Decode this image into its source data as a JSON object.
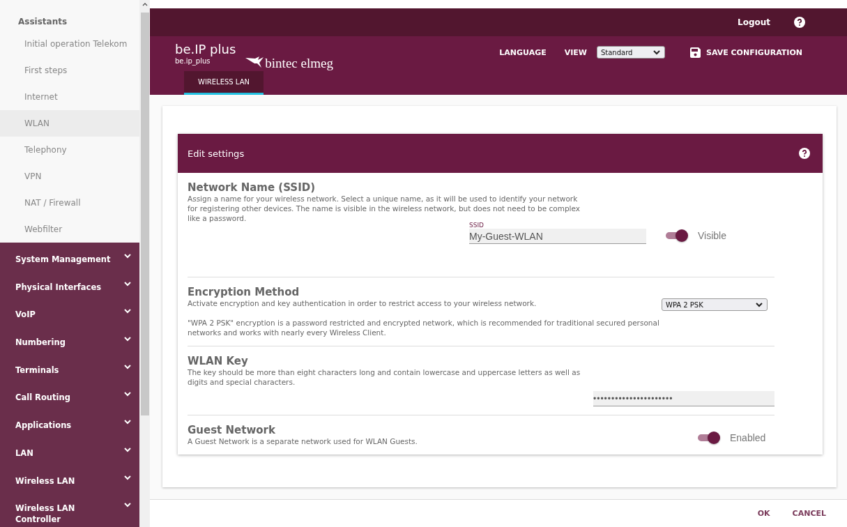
{
  "sidebar": {
    "section_title": "Assistants",
    "items": [
      {
        "label": "Initial operation Telekom",
        "selected": false
      },
      {
        "label": "First steps",
        "selected": false
      },
      {
        "label": "Internet",
        "selected": false
      },
      {
        "label": "WLAN",
        "selected": true
      },
      {
        "label": "Telephony",
        "selected": false
      },
      {
        "label": "VPN",
        "selected": false
      },
      {
        "label": "NAT / Firewall",
        "selected": false
      },
      {
        "label": "Webfilter",
        "selected": false
      }
    ],
    "groups": [
      {
        "label": "System Management",
        "expanded": false
      },
      {
        "label": "Physical Interfaces",
        "expanded": false
      },
      {
        "label": "VoIP",
        "expanded": false
      },
      {
        "label": "Numbering",
        "expanded": false
      },
      {
        "label": "Terminals",
        "expanded": false
      },
      {
        "label": "Call Routing",
        "expanded": false
      },
      {
        "label": "Applications",
        "expanded": false
      },
      {
        "label": "LAN",
        "expanded": false
      },
      {
        "label": "Wireless LAN",
        "expanded": false
      },
      {
        "label": "Wireless LAN Controller",
        "expanded": false
      }
    ]
  },
  "topbar": {
    "logout": "Logout"
  },
  "header": {
    "device": "be.IP plus",
    "hostname": "be.ip_plus",
    "brand": "bintec elmeg",
    "language": "LANGUAGE",
    "view_label": "VIEW",
    "view_value": "Standard",
    "save": "SAVE CONFIGURATION",
    "tabs": [
      {
        "label": "WIRELESS LAN",
        "selected": true
      }
    ]
  },
  "panel": {
    "title": "Edit settings",
    "sections": [
      {
        "kind": "text",
        "title": "Network Name (SSID)",
        "description": "Assign a name for your wireless network. Select a unique name, as it will be used to identify your network for registering other devices. The name is visible in the wireless network, but does not need to be complex like a password.",
        "field_label": "SSID",
        "value": "My-Guest-WLAN",
        "toggle": {
          "label": "Visible",
          "on": true
        }
      },
      {
        "kind": "select",
        "title": "Encryption Method",
        "description": "Activate encryption and key authentication in order to restrict access to your wireless network.",
        "value": "WPA 2 PSK",
        "note": "\"WPA 2 PSK\" encryption is a password restricted and encrypted network, which is recommended for traditional secured personal networks and works with nearly every Wireless Client."
      },
      {
        "kind": "password",
        "title": "WLAN Key",
        "description": "The key should be more than eight characters long and contain lowercase and uppercase letters as well as digits and special characters.",
        "value": "••••••••••••••••••••••"
      },
      {
        "kind": "toggle",
        "title": "Guest Network",
        "description": "A Guest Network is a separate network used for WLAN Guests.",
        "toggle": {
          "label": "Enabled",
          "on": true
        }
      }
    ]
  },
  "footer": {
    "buttons": [
      "OK",
      "CANCEL"
    ]
  }
}
